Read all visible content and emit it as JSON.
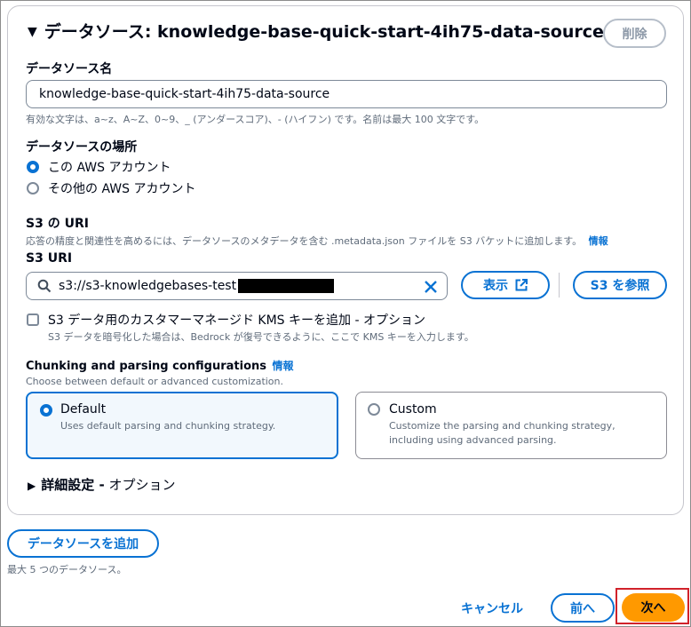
{
  "section": {
    "title": "データソース: knowledge-base-quick-start-4ih75-data-source",
    "delete_label": "削除"
  },
  "datasource_name": {
    "label": "データソース名",
    "value": "knowledge-base-quick-start-4ih75-data-source",
    "hint": "有効な文字は、a~z、A~Z、0~9、_ (アンダースコア)、- (ハイフン) です。名前は最大 100 文字です。"
  },
  "location": {
    "label": "データソースの場所",
    "options": [
      {
        "label": "この AWS アカウント",
        "selected": true
      },
      {
        "label": "その他の AWS アカウント",
        "selected": false
      }
    ]
  },
  "s3": {
    "heading": "S3 の URI",
    "description": "応答の精度と関連性を高めるには、データソースのメタデータを含む .metadata.json ファイルを S3 バケットに追加します。",
    "info_link": "情報",
    "uri_label": "S3 URI",
    "uri_value": "s3://s3-knowledgebases-test",
    "view_button": "表示",
    "browse_button": "S3 を参照"
  },
  "kms": {
    "label": "S3 データ用のカスタマーマネージド KMS キーを追加 - オプション",
    "hint": "S3 データを暗号化した場合は、Bedrock が復号できるように、ここで KMS キーを入力します。"
  },
  "chunking": {
    "heading": "Chunking and parsing configurations",
    "info_link": "情報",
    "description": "Choose between default or advanced customization.",
    "options": [
      {
        "title": "Default",
        "desc": "Uses default parsing and chunking strategy.",
        "selected": true
      },
      {
        "title": "Custom",
        "desc_line1": "Customize the parsing and chunking strategy,",
        "desc_line2": "including using advanced parsing.",
        "selected": false
      }
    ]
  },
  "advanced": {
    "label_bold": "詳細設定 -",
    "label_rest": " オプション"
  },
  "add_datasource": {
    "button": "データソースを追加",
    "hint": "最大 5 つのデータソース。"
  },
  "footer": {
    "cancel": "キャンセル",
    "previous": "前へ",
    "next": "次へ"
  },
  "colors": {
    "accent": "#0972d3",
    "primary_button": "#ff9900",
    "highlight_box": "#d1222a"
  }
}
